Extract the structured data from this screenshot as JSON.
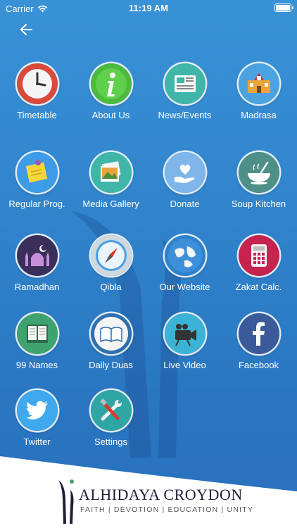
{
  "status": {
    "carrier": "Carrier",
    "time": "11:19 AM"
  },
  "colors": {
    "accent": "#2f82cb",
    "footer": "#ffffff"
  },
  "tiles": [
    {
      "label": "Timetable",
      "icon": "clock-icon"
    },
    {
      "label": "About Us",
      "icon": "info-icon"
    },
    {
      "label": "News/Events",
      "icon": "newspaper-icon"
    },
    {
      "label": "Madrasa",
      "icon": "school-icon"
    },
    {
      "label": "Regular Prog.",
      "icon": "sticky-note-icon"
    },
    {
      "label": "Media Gallery",
      "icon": "photos-icon"
    },
    {
      "label": "Donate",
      "icon": "donate-heart-icon"
    },
    {
      "label": "Soup Kitchen",
      "icon": "soup-bowl-icon"
    },
    {
      "label": "Ramadhan",
      "icon": "mosque-icon"
    },
    {
      "label": "Qibla",
      "icon": "compass-icon"
    },
    {
      "label": "Our Website",
      "icon": "globe-icon"
    },
    {
      "label": "Zakat Calc.",
      "icon": "calculator-icon"
    },
    {
      "label": "99 Names",
      "icon": "book-icon"
    },
    {
      "label": "Daily Duas",
      "icon": "open-book-icon"
    },
    {
      "label": "Live Video",
      "icon": "video-camera-icon"
    },
    {
      "label": "Facebook",
      "icon": "facebook-icon"
    },
    {
      "label": "Twitter",
      "icon": "twitter-icon"
    },
    {
      "label": "Settings",
      "icon": "settings-tools-icon"
    }
  ],
  "footer": {
    "name": "ALHIDAYA CROYDON",
    "tagline": "FAITH | DEVOTION | EDUCATION | UNITY"
  }
}
